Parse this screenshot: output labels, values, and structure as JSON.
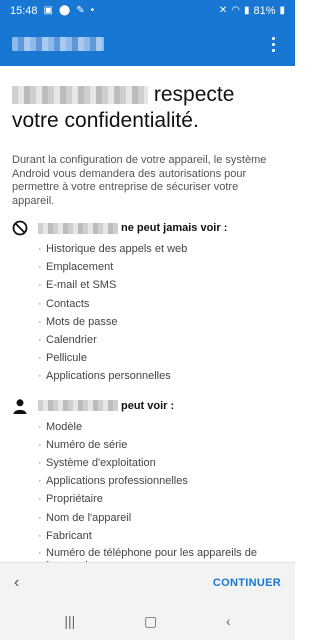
{
  "status": {
    "time": "15:48",
    "battery": "81%"
  },
  "headline": {
    "line1_suffix": "respecte",
    "line2": "votre confidentialité."
  },
  "intro": "Durant la configuration de votre appareil, le système Android vous demandera des autorisations pour permettre à votre entreprise de sécuriser votre appareil.",
  "cannot_see": {
    "title_suffix": "ne peut jamais voir :",
    "items": [
      "Historique des appels et web",
      "Emplacement",
      "E-mail et SMS",
      "Contacts",
      "Mots de passe",
      "Calendrier",
      "Pellicule",
      "Applications personnelles"
    ]
  },
  "can_see": {
    "title_suffix": "peut voir :",
    "items": [
      "Modèle",
      "Numéro de série",
      "Système d'exploitation",
      "Applications professionnelles",
      "Propriétaire",
      "Nom de l'appareil",
      "Fabricant",
      "Numéro de téléphone pour les appareils de l'entreprise"
    ]
  },
  "buttons": {
    "continue": "CONTINUER"
  },
  "colors": {
    "primary": "#1877d2"
  }
}
